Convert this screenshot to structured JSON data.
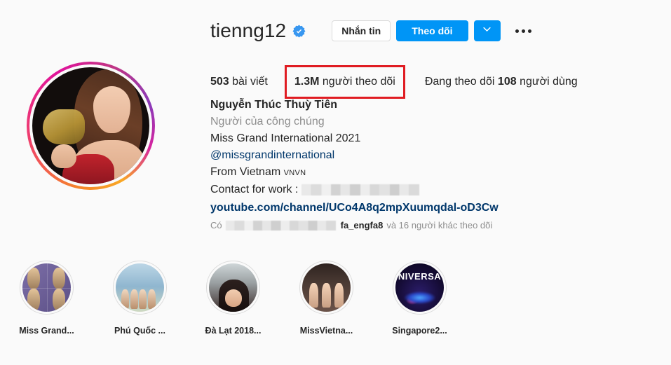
{
  "profile": {
    "username": "tienng12",
    "verified_icon": "verified-badge-icon",
    "avatar_alt": "profile-picture"
  },
  "actions": {
    "message_label": "Nhắn tin",
    "follow_label": "Theo dõi",
    "caret_icon": "chevron-down-icon",
    "more_icon": "ellipsis-icon"
  },
  "stats": {
    "posts_count": "503",
    "posts_label": "bài viết",
    "followers_count": "1.3M",
    "followers_label": "người theo dõi",
    "following_prefix": "Đang theo dõi",
    "following_count": "108",
    "following_label": "người dùng",
    "highlight_color": "#e01c22"
  },
  "bio": {
    "full_name": "Nguyễn Thúc Thuỳ Tiên",
    "category": "Người của công chúng",
    "line_title": "Miss Grand International 2021",
    "mention": "@missgrandinternational",
    "from_prefix": "From Vietnam",
    "from_flag": "VNVN",
    "contact_label": "Contact for work :",
    "contact_value_redacted": "",
    "link": "youtube.com/channel/UCo4A8q2mpXuumqdal-oD3Cw"
  },
  "followed_by": {
    "prefix": "Có",
    "redacted_names": "",
    "known_user": "fa_engfa8",
    "suffix": "và 16 người khác theo dõi"
  },
  "highlights": [
    {
      "label": "Miss Grand...",
      "thumb": "hl1"
    },
    {
      "label": "Phú Quốc ...",
      "thumb": "hl2"
    },
    {
      "label": "Đà Lạt 2018...",
      "thumb": "hl3"
    },
    {
      "label": "MissVietna...",
      "thumb": "hl4"
    },
    {
      "label": "Singapore2...",
      "thumb": "hl5",
      "thumb_text": "NIVERSA"
    }
  ],
  "theme": {
    "background": "#fafafa",
    "primary_text": "#262626",
    "secondary_text": "#8e8e8e",
    "link_color": "#00376b",
    "accent_blue": "#0095f6"
  }
}
